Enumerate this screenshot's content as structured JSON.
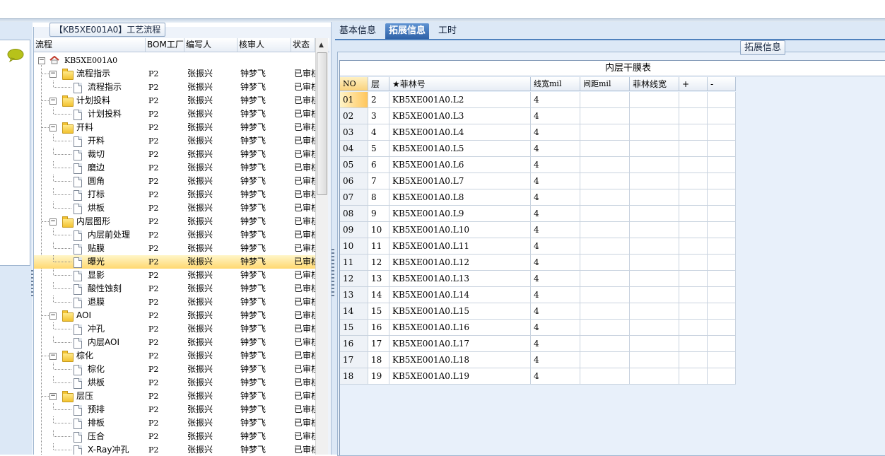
{
  "tree_panel": {
    "title": "【KB5XE001A0】工艺流程",
    "columns": [
      "流程",
      "BOM工厂",
      "编写人",
      "核审人",
      "状态"
    ],
    "rows": [
      {
        "label": "KB5XE001A0",
        "level": 0,
        "type": "root",
        "bom": "",
        "writer": "",
        "reviewer": "",
        "status": ""
      },
      {
        "label": "流程指示",
        "level": 1,
        "type": "folder",
        "bom": "P2",
        "writer": "张振兴",
        "reviewer": "钟梦飞",
        "status": "已审核"
      },
      {
        "label": "流程指示",
        "level": 2,
        "type": "doc",
        "bom": "P2",
        "writer": "张振兴",
        "reviewer": "钟梦飞",
        "status": "已审核"
      },
      {
        "label": "计划投料",
        "level": 1,
        "type": "folder",
        "bom": "P2",
        "writer": "张振兴",
        "reviewer": "钟梦飞",
        "status": "已审核"
      },
      {
        "label": "计划投料",
        "level": 2,
        "type": "doc",
        "bom": "P2",
        "writer": "张振兴",
        "reviewer": "钟梦飞",
        "status": "已审核"
      },
      {
        "label": "开料",
        "level": 1,
        "type": "folder",
        "bom": "P2",
        "writer": "张振兴",
        "reviewer": "钟梦飞",
        "status": "已审核"
      },
      {
        "label": "开料",
        "level": 2,
        "type": "doc",
        "bom": "P2",
        "writer": "张振兴",
        "reviewer": "钟梦飞",
        "status": "已审核"
      },
      {
        "label": "裁切",
        "level": 2,
        "type": "doc",
        "bom": "P2",
        "writer": "张振兴",
        "reviewer": "钟梦飞",
        "status": "已审核"
      },
      {
        "label": "磨边",
        "level": 2,
        "type": "doc",
        "bom": "P2",
        "writer": "张振兴",
        "reviewer": "钟梦飞",
        "status": "已审核"
      },
      {
        "label": "圆角",
        "level": 2,
        "type": "doc",
        "bom": "P2",
        "writer": "张振兴",
        "reviewer": "钟梦飞",
        "status": "已审核"
      },
      {
        "label": "打标",
        "level": 2,
        "type": "doc",
        "bom": "P2",
        "writer": "张振兴",
        "reviewer": "钟梦飞",
        "status": "已审核"
      },
      {
        "label": "烘板",
        "level": 2,
        "type": "doc",
        "bom": "P2",
        "writer": "张振兴",
        "reviewer": "钟梦飞",
        "status": "已审核"
      },
      {
        "label": "内层图形",
        "level": 1,
        "type": "folder",
        "bom": "P2",
        "writer": "张振兴",
        "reviewer": "钟梦飞",
        "status": "已审核"
      },
      {
        "label": "内层前处理",
        "level": 2,
        "type": "doc",
        "bom": "P2",
        "writer": "张振兴",
        "reviewer": "钟梦飞",
        "status": "已审核"
      },
      {
        "label": "贴膜",
        "level": 2,
        "type": "doc",
        "bom": "P2",
        "writer": "张振兴",
        "reviewer": "钟梦飞",
        "status": "已审核"
      },
      {
        "label": "曝光",
        "level": 2,
        "type": "doc",
        "bom": "P2",
        "writer": "张振兴",
        "reviewer": "钟梦飞",
        "status": "已审核",
        "selected": true
      },
      {
        "label": "显影",
        "level": 2,
        "type": "doc",
        "bom": "P2",
        "writer": "张振兴",
        "reviewer": "钟梦飞",
        "status": "已审核"
      },
      {
        "label": "酸性蚀刻",
        "level": 2,
        "type": "doc",
        "bom": "P2",
        "writer": "张振兴",
        "reviewer": "钟梦飞",
        "status": "已审核"
      },
      {
        "label": "退膜",
        "level": 2,
        "type": "doc",
        "bom": "P2",
        "writer": "张振兴",
        "reviewer": "钟梦飞",
        "status": "已审核"
      },
      {
        "label": "AOI",
        "level": 1,
        "type": "folder",
        "bom": "P2",
        "writer": "张振兴",
        "reviewer": "钟梦飞",
        "status": "已审核"
      },
      {
        "label": "冲孔",
        "level": 2,
        "type": "doc",
        "bom": "P2",
        "writer": "张振兴",
        "reviewer": "钟梦飞",
        "status": "已审核"
      },
      {
        "label": "内层AOI",
        "level": 2,
        "type": "doc",
        "bom": "P2",
        "writer": "张振兴",
        "reviewer": "钟梦飞",
        "status": "已审核"
      },
      {
        "label": "棕化",
        "level": 1,
        "type": "folder",
        "bom": "P2",
        "writer": "张振兴",
        "reviewer": "钟梦飞",
        "status": "已审核"
      },
      {
        "label": "棕化",
        "level": 2,
        "type": "doc",
        "bom": "P2",
        "writer": "张振兴",
        "reviewer": "钟梦飞",
        "status": "已审核"
      },
      {
        "label": "烘板",
        "level": 2,
        "type": "doc",
        "bom": "P2",
        "writer": "张振兴",
        "reviewer": "钟梦飞",
        "status": "已审核"
      },
      {
        "label": "层压",
        "level": 1,
        "type": "folder",
        "bom": "P2",
        "writer": "张振兴",
        "reviewer": "钟梦飞",
        "status": "已审核"
      },
      {
        "label": "预排",
        "level": 2,
        "type": "doc",
        "bom": "P2",
        "writer": "张振兴",
        "reviewer": "钟梦飞",
        "status": "已审核"
      },
      {
        "label": "排板",
        "level": 2,
        "type": "doc",
        "bom": "P2",
        "writer": "张振兴",
        "reviewer": "钟梦飞",
        "status": "已审核"
      },
      {
        "label": "压合",
        "level": 2,
        "type": "doc",
        "bom": "P2",
        "writer": "张振兴",
        "reviewer": "钟梦飞",
        "status": "已审核"
      },
      {
        "label": "X-Ray冲孔",
        "level": 2,
        "type": "doc",
        "bom": "P2",
        "writer": "张振兴",
        "reviewer": "钟梦飞",
        "status": "已审核"
      }
    ]
  },
  "tabs": [
    {
      "label": "基本信息",
      "active": false
    },
    {
      "label": "拓展信息",
      "active": true
    },
    {
      "label": "工时",
      "active": false
    }
  ],
  "info_panel": {
    "legend": "拓展信息",
    "grid_caption": "内层干膜表",
    "columns": [
      "NO",
      "层",
      "★菲林号",
      "线宽mil",
      "间距mil",
      "菲林线宽",
      "+",
      "-"
    ],
    "rows": [
      {
        "no": "01",
        "layer": "2",
        "film": "KB5XE001A0.L2",
        "width": "4",
        "spacing": "",
        "film_width": "",
        "selected": true
      },
      {
        "no": "02",
        "layer": "3",
        "film": "KB5XE001A0.L3",
        "width": "4",
        "spacing": "",
        "film_width": ""
      },
      {
        "no": "03",
        "layer": "4",
        "film": "KB5XE001A0.L4",
        "width": "4",
        "spacing": "",
        "film_width": ""
      },
      {
        "no": "04",
        "layer": "5",
        "film": "KB5XE001A0.L5",
        "width": "4",
        "spacing": "",
        "film_width": ""
      },
      {
        "no": "05",
        "layer": "6",
        "film": "KB5XE001A0.L6",
        "width": "4",
        "spacing": "",
        "film_width": ""
      },
      {
        "no": "06",
        "layer": "7",
        "film": "KB5XE001A0.L7",
        "width": "4",
        "spacing": "",
        "film_width": ""
      },
      {
        "no": "07",
        "layer": "8",
        "film": "KB5XE001A0.L8",
        "width": "4",
        "spacing": "",
        "film_width": ""
      },
      {
        "no": "08",
        "layer": "9",
        "film": "KB5XE001A0.L9",
        "width": "4",
        "spacing": "",
        "film_width": ""
      },
      {
        "no": "09",
        "layer": "10",
        "film": "KB5XE001A0.L10",
        "width": "4",
        "spacing": "",
        "film_width": ""
      },
      {
        "no": "10",
        "layer": "11",
        "film": "KB5XE001A0.L11",
        "width": "4",
        "spacing": "",
        "film_width": ""
      },
      {
        "no": "11",
        "layer": "12",
        "film": "KB5XE001A0.L12",
        "width": "4",
        "spacing": "",
        "film_width": ""
      },
      {
        "no": "12",
        "layer": "13",
        "film": "KB5XE001A0.L13",
        "width": "4",
        "spacing": "",
        "film_width": ""
      },
      {
        "no": "13",
        "layer": "14",
        "film": "KB5XE001A0.L14",
        "width": "4",
        "spacing": "",
        "film_width": ""
      },
      {
        "no": "14",
        "layer": "15",
        "film": "KB5XE001A0.L15",
        "width": "4",
        "spacing": "",
        "film_width": ""
      },
      {
        "no": "15",
        "layer": "16",
        "film": "KB5XE001A0.L16",
        "width": "4",
        "spacing": "",
        "film_width": ""
      },
      {
        "no": "16",
        "layer": "17",
        "film": "KB5XE001A0.L17",
        "width": "4",
        "spacing": "",
        "film_width": ""
      },
      {
        "no": "17",
        "layer": "18",
        "film": "KB5XE001A0.L18",
        "width": "4",
        "spacing": "",
        "film_width": ""
      },
      {
        "no": "18",
        "layer": "19",
        "film": "KB5XE001A0.L19",
        "width": "4",
        "spacing": "",
        "film_width": ""
      }
    ]
  },
  "icons": {
    "chat": "speech-bubble-icon",
    "root": "house-icon",
    "folder": "folder-icon",
    "doc": "document-icon"
  },
  "colors": {
    "accent": "#2f62a8",
    "selection": "#ffd870",
    "chat_icon": "#b7c21a"
  }
}
